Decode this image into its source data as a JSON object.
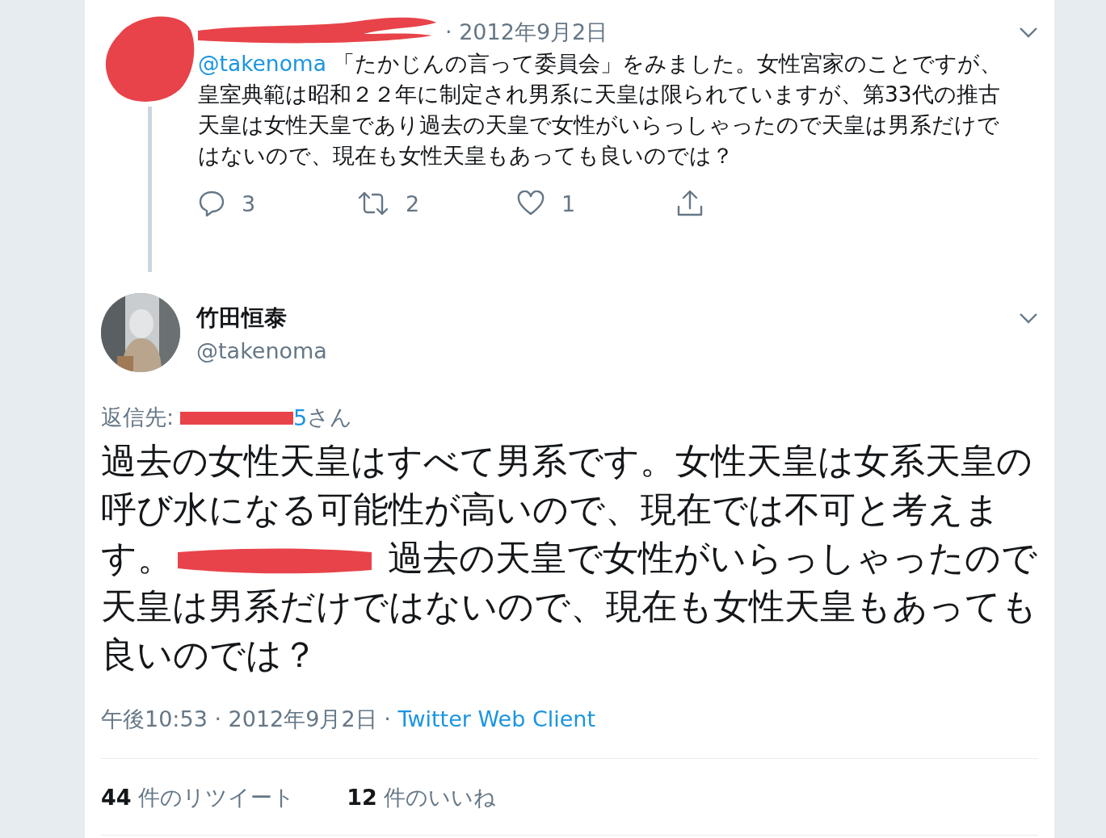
{
  "parent_tweet": {
    "date": "· 2012年9月2日",
    "mention": "@takenoma",
    "text": " 「たかじんの言って委員会」をみました。女性宮家のことですが、皇室典範は昭和２２年に制定され男系に天皇は限られていますが、第33代の推古天皇は女性天皇であり過去の天皇で女性がいらっしゃったので天皇は男系だけではないので、現在も女性天皇もあっても良いのでは？",
    "actions": [
      {
        "kind": "reply",
        "count": "3"
      },
      {
        "kind": "retweet",
        "count": "2"
      },
      {
        "kind": "like",
        "count": "1"
      },
      {
        "kind": "share"
      }
    ]
  },
  "tweet": {
    "name": "竹田恒泰",
    "handle": "@takenoma",
    "reply_to": {
      "label": "返信先:",
      "mention_tail": "5",
      "suffix": "さん"
    },
    "text_before": "過去の女性天皇はすべて男系です。女性天皇は女系天皇の呼び水になる可能性が高いので、現在では不可と考えます。",
    "text_after": " 過去の天皇で女性がいらっしゃったので天皇は男系だけではないので、現在も女性天皇もあっても良いのでは？",
    "time": "午後10:53 · 2012年9月2日 · ",
    "source": "Twitter Web Client",
    "stats": [
      {
        "count": "44",
        "label": "件のリツイート"
      },
      {
        "count": "12",
        "label": "件のいいね"
      }
    ]
  }
}
